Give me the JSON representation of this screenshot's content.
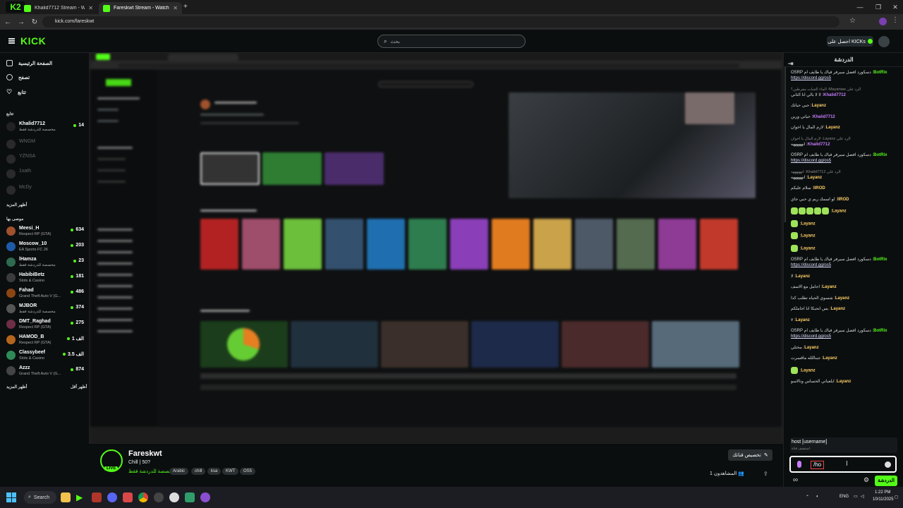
{
  "browser": {
    "tabs": [
      {
        "title": "Khalid7712 Stream - Watch Live",
        "active": false
      },
      {
        "title": "Fareskwt Stream - Watch Live",
        "active": true
      }
    ],
    "url": "kick.com/fareskwt"
  },
  "header": {
    "logo": "KICK",
    "search_placeholder": "بحث",
    "get_kicks_label": "احصل على KICKs"
  },
  "sidebar": {
    "nav": [
      {
        "label": "الصفحة الرئيسية",
        "icon": "home-icon"
      },
      {
        "label": "تصفح",
        "icon": "compass-icon"
      },
      {
        "label": "تتابع",
        "icon": "heart-icon"
      }
    ],
    "following_title": "تتابع",
    "following": [
      {
        "name": "Khalid7712",
        "category": "مخصصة للدردشة فقط",
        "viewers": "14",
        "live": true
      },
      {
        "name": "WNGM",
        "category": "",
        "viewers": "",
        "live": false
      },
      {
        "name": "YZNSA",
        "category": "",
        "viewers": "",
        "live": false
      },
      {
        "name": "1xath",
        "category": "",
        "viewers": "",
        "live": false
      },
      {
        "name": "McDy",
        "category": "",
        "viewers": "",
        "live": false
      }
    ],
    "show_more": "أظهر المزيد",
    "recommended_title": "موصى بها",
    "recommended": [
      {
        "name": "Meesi_H",
        "category": "Respect RP (GTA)",
        "viewers": "634"
      },
      {
        "name": "Moscow_10",
        "category": "EA Sports FC 26",
        "viewers": "203"
      },
      {
        "name": "lHamza",
        "category": "مخصصة للدردشة فقط",
        "viewers": "23"
      },
      {
        "name": "HabibiBetz",
        "category": "Slots & Casino",
        "viewers": "181"
      },
      {
        "name": "Fahad",
        "category": "Grand Theft Auto V (G...",
        "viewers": "486"
      },
      {
        "name": "MJBOR",
        "category": "مخصصة للدردشة فقط",
        "viewers": "374"
      },
      {
        "name": "DMT_Raghad",
        "category": "Respect RP (GTA)",
        "viewers": "275"
      },
      {
        "name": "HAMOD_B",
        "category": "Respect RP (GTA)",
        "viewers": "1 الف"
      },
      {
        "name": "Classybeef",
        "category": "Slots & Casino",
        "viewers": "3.5 الف"
      },
      {
        "name": "Azzz",
        "category": "Grand Theft Auto V (G...",
        "viewers": "874"
      }
    ],
    "show_more_2": "أظهر المزيد",
    "show_less": "أظهر أقل"
  },
  "stream": {
    "name": "Fareskwt",
    "title": "Chill | 50?",
    "category": "مخصصة للدردشة فقط",
    "tags": [
      "Arabic",
      "chill",
      "ksa",
      "KWT",
      "OS5"
    ],
    "live_label": "LIVE",
    "customize_label": "تخصيص قناتك",
    "viewers_label": "المشاهدون 1"
  },
  "chat": {
    "title": "الدردشة",
    "messages": [
      {
        "user": "BotRix",
        "type": "bot",
        "text": "دسكورد افضل سيرفر فياك يا طايف ام OSRP",
        "link": "https://discord.gg/os5"
      },
      {
        "user": "Khalid7712",
        "type": "p",
        "reply": "الرد على Mayartaw: الماء الحيات مفرطين؟",
        "text": "لا لا بالي انا الثاني"
      },
      {
        "user": "Layanz",
        "type": "y",
        "text": "حبي حياتك"
      },
      {
        "user": "Khalid7712",
        "type": "p",
        "text": "حياتي ورين"
      },
      {
        "user": "Layanz",
        "type": "y",
        "text": "لازم المال يا اخوان"
      },
      {
        "user": "Khalid7712",
        "type": "p",
        "reply": "الرد على Layanz: لازم المال يا اخوان",
        "text": "انهههههه"
      },
      {
        "user": "BotRix",
        "type": "bot",
        "text": "دسكورد افضل سيرفر فياك يا طايف ام OSRP",
        "link": "https://discord.gg/os5"
      },
      {
        "user": "Layanz",
        "type": "y",
        "reply": "الرد على Khalid7712: انهههههه",
        "text": "انهههههه"
      },
      {
        "user": "lIROD",
        "type": "y",
        "text": "سلام عليكم"
      },
      {
        "user": "lIROD",
        "type": "y",
        "text": "لو اسمك ريم ي حبي جاي"
      },
      {
        "user": "Layanz",
        "type": "y",
        "text": "",
        "emotes": 5
      },
      {
        "user": "Layanz",
        "type": "y",
        "text": "",
        "emotes": 1
      },
      {
        "user": "Layanz",
        "type": "y",
        "text": "",
        "emotes": 1
      },
      {
        "user": "Layanz",
        "type": "y",
        "text": "",
        "emotes": 1
      },
      {
        "user": "BotRix",
        "type": "bot",
        "text": "دسكورد افضل سيرفر فياك يا طايف ام OSRP",
        "link": "https://discord.gg/os5"
      },
      {
        "user": "Layanz",
        "type": "y",
        "text": "لا"
      },
      {
        "user": "Layanz",
        "type": "y",
        "text": "اجامل مع الاسف"
      },
      {
        "user": "Layanz",
        "type": "y",
        "text": "شسوي الحياه تطلب كذا"
      },
      {
        "user": "Layanz",
        "type": "y",
        "text": "بس انحبكا انا اجاملكم"
      },
      {
        "user": "Layanz",
        "type": "y",
        "text": "٧"
      },
      {
        "user": "BotRix",
        "type": "bot",
        "text": "دسكورد افضل سيرفر فياك يا طايف ام OSRP",
        "link": "https://discord.gg/os5"
      },
      {
        "user": "Layanz",
        "type": "y",
        "text": "مختلي"
      },
      {
        "user": "Layanz",
        "type": "y",
        "text": "جبناللله ماقسرت"
      },
      {
        "user": "Layanz",
        "type": "y",
        "text": "",
        "emotes": 1
      },
      {
        "user": "Layanz",
        "type": "y",
        "text": "ابلعياتي الحساس ونالاسو"
      }
    ],
    "suggest_cmd": "host [username]",
    "suggest_hint": "استضف قناة",
    "input_value": "/ho",
    "send_label": "الدردشة"
  },
  "taskbar": {
    "search_label": "Search",
    "lang": "ENG",
    "time": "1:22 PM",
    "date": "10/11/2025"
  },
  "colors": {
    "brand": "#53fc18",
    "bg": "#0b0e0f"
  }
}
